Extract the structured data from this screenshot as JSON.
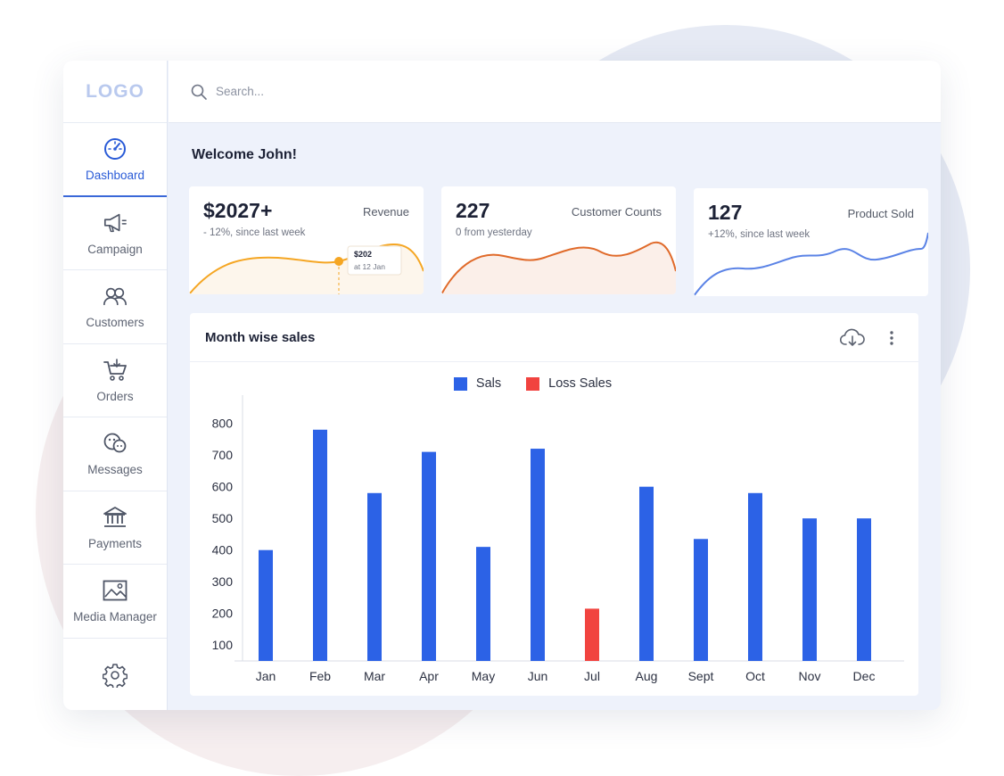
{
  "app": {
    "logo": "LOGO"
  },
  "sidebar": {
    "items": [
      {
        "label": "Dashboard",
        "icon": "dashboard-gauge-icon",
        "active": true
      },
      {
        "label": "Campaign",
        "icon": "megaphone-icon"
      },
      {
        "label": "Customers",
        "icon": "users-icon"
      },
      {
        "label": "Orders",
        "icon": "cart-icon"
      },
      {
        "label": "Messages",
        "icon": "chat-bubbles-icon"
      },
      {
        "label": "Payments",
        "icon": "bank-icon"
      },
      {
        "label": "Media Manager",
        "icon": "image-icon"
      }
    ],
    "settings_icon": "gear-icon"
  },
  "search": {
    "placeholder": "Search..."
  },
  "welcome": "Welcome John!",
  "cards": [
    {
      "value": "$2027+",
      "label": "Revenue",
      "sub": "- 12%, since last week",
      "color": "#f5a623",
      "fill": "#fdf6ec",
      "tooltip": {
        "value": "$202",
        "date": "at 12 Jan"
      }
    },
    {
      "value": "227",
      "label": "Customer Counts",
      "sub": "0 from yesterday",
      "color": "#e06a2a",
      "fill": "#fbefe9"
    },
    {
      "value": "127",
      "label": "Product Sold",
      "sub": "+12%, since last week",
      "color": "#5b83e6",
      "fill": "#ffffff"
    }
  ],
  "panel": {
    "title": "Month wise sales",
    "download_icon": "cloud-download-icon",
    "more_icon": "more-vertical-icon"
  },
  "chart_data": {
    "type": "bar",
    "categories": [
      "Jan",
      "Feb",
      "Mar",
      "Apr",
      "May",
      "Jun",
      "Jul",
      "Aug",
      "Sept",
      "Oct",
      "Nov",
      "Dec"
    ],
    "series": [
      {
        "name": "Sals",
        "color": "#2c62e6",
        "values": [
          400,
          780,
          580,
          710,
          410,
          720,
          null,
          600,
          435,
          580,
          500,
          500
        ]
      },
      {
        "name": "Loss Sales",
        "color": "#f1433f",
        "values": [
          null,
          null,
          null,
          null,
          null,
          null,
          215,
          null,
          null,
          null,
          null,
          null
        ]
      }
    ],
    "yticks": [
      100,
      200,
      300,
      400,
      500,
      600,
      700,
      800
    ],
    "ylim": [
      50,
      830
    ],
    "legend": "top-center",
    "grid": false
  }
}
